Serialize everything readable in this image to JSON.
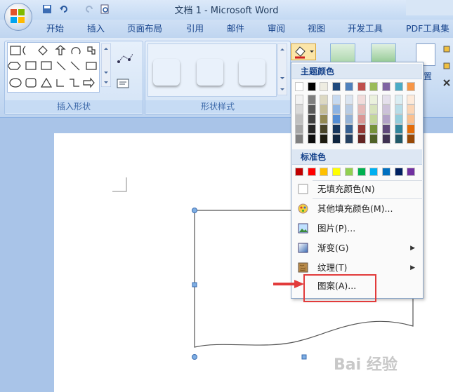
{
  "window": {
    "title": "文档 1 - Microsoft Word"
  },
  "tabs": [
    "开始",
    "插入",
    "页面布局",
    "引用",
    "邮件",
    "审阅",
    "视图",
    "开发工具",
    "PDF工具集"
  ],
  "groups": {
    "insert_shapes": "插入形状",
    "shape_styles": "形状样式",
    "arrange_partial": "置"
  },
  "style_swatches": [
    "#0a0a0a",
    "#5b9bd5",
    "#ed7d31"
  ],
  "fill_menu": {
    "theme_header": "主题颜色",
    "standard_header": "标准色",
    "theme_colors": [
      [
        "#ffffff",
        "#f2f2f2",
        "#d9d9d9",
        "#bfbfbf",
        "#a6a6a6",
        "#7f7f7f"
      ],
      [
        "#000000",
        "#7f7f7f",
        "#595959",
        "#404040",
        "#262626",
        "#0d0d0d"
      ],
      [
        "#eeece1",
        "#ddd9c3",
        "#c4bd97",
        "#938953",
        "#494429",
        "#1d1b10"
      ],
      [
        "#1f497d",
        "#c6d9f0",
        "#8db3e2",
        "#548dd4",
        "#17365d",
        "#0f243e"
      ],
      [
        "#4f81bd",
        "#dbe5f1",
        "#b8cce4",
        "#95b3d7",
        "#366092",
        "#244061"
      ],
      [
        "#c0504d",
        "#f2dcdb",
        "#e5b9b7",
        "#d99694",
        "#953734",
        "#632423"
      ],
      [
        "#9bbb59",
        "#ebf1dd",
        "#d7e3bc",
        "#c3d69b",
        "#76923c",
        "#4f6128"
      ],
      [
        "#8064a2",
        "#e5e0ec",
        "#ccc1d9",
        "#b2a2c7",
        "#5f497a",
        "#3f3151"
      ],
      [
        "#4bacc6",
        "#dbeef3",
        "#b7dde8",
        "#92cddc",
        "#31859b",
        "#205867"
      ],
      [
        "#f79646",
        "#fdeada",
        "#fbd5b5",
        "#fac08f",
        "#e36c09",
        "#974806"
      ]
    ],
    "standard_colors": [
      "#c00000",
      "#ff0000",
      "#ffc000",
      "#ffff00",
      "#92d050",
      "#00b050",
      "#00b0f0",
      "#0070c0",
      "#002060",
      "#7030a0"
    ],
    "items": [
      {
        "label": "无填充颜色(N)",
        "icon": "no-fill-icon",
        "submenu": false
      },
      {
        "label": "其他填充颜色(M)...",
        "icon": "more-colors-icon",
        "submenu": false
      },
      {
        "label": "图片(P)...",
        "icon": "picture-icon",
        "submenu": false
      },
      {
        "label": "渐变(G)",
        "icon": "gradient-icon",
        "submenu": true
      },
      {
        "label": "纹理(T)",
        "icon": "texture-icon",
        "submenu": true
      },
      {
        "label": "图案(A)...",
        "icon": "pattern-icon",
        "submenu": false
      }
    ],
    "highlighted_item": "图案(A)..."
  },
  "watermark": "Bai 经验"
}
